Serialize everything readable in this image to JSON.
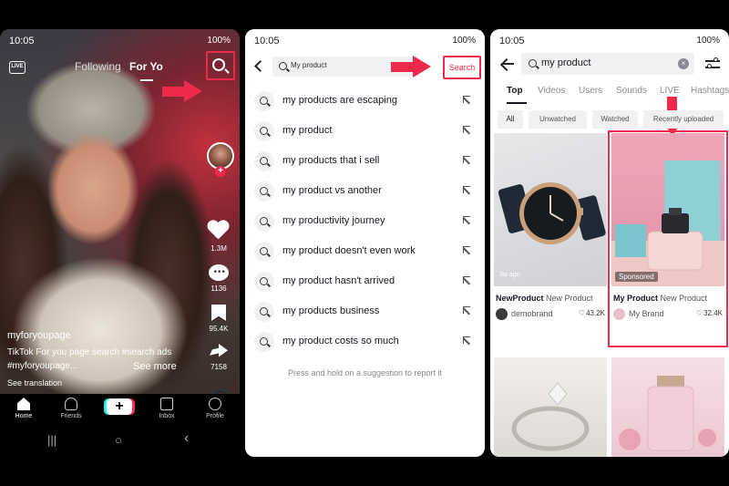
{
  "phone1": {
    "time": "10:05",
    "battery": "100%",
    "live_label": "LIVE",
    "tabs": {
      "following": "Following",
      "for_you": "For Yo"
    },
    "actions": {
      "likes": "1.3M",
      "comments": "1136",
      "saves": "95.4K",
      "shares": "7158"
    },
    "caption": {
      "username": "myforyoupage",
      "line1": "TikTok For you page search #search ads",
      "line2": "#myforyoupage...",
      "see_more": "See more",
      "see_translation": "See translation"
    },
    "bottom_nav": {
      "home": "Home",
      "friends": "Friends",
      "plus": "+",
      "inbox": "Inbox",
      "profile": "Profile"
    },
    "system_nav": {
      "recents": "|||",
      "home": "○",
      "back": "‹"
    }
  },
  "phone2": {
    "time": "10:05",
    "battery": "100%",
    "search_value": "My product",
    "search_button": "Search",
    "suggestions": [
      "my products are escaping",
      "my product",
      "my products that i sell",
      "my product vs another",
      "my productivity journey",
      "my product doesn't even work",
      "my product hasn't arrived",
      "my products business",
      "my product costs so much"
    ],
    "hint": "Press and hold on a suggestion to report it"
  },
  "phone3": {
    "time": "10:05",
    "battery": "100%",
    "search_value": "my product",
    "clear": "×",
    "tabs": [
      "Top",
      "Videos",
      "Users",
      "Sounds",
      "LIVE",
      "Hashtags"
    ],
    "chips": [
      "All",
      "Unwatched",
      "Watched",
      "Recently uploaded"
    ],
    "cards": [
      {
        "time_ago": "3w ago",
        "title_bold": "NewProduct",
        "title_rest": "New Product",
        "author": "demobrand",
        "likes": "43.2K"
      },
      {
        "sponsored": "Sponsored",
        "title_bold": "My Product",
        "title_rest": "New Product",
        "author": "My Brand",
        "likes": "32.4K"
      }
    ]
  },
  "colors": {
    "accent_red": "#ee2a4c",
    "text_dark": "#161823",
    "chip_bg": "#f1f1f2"
  }
}
